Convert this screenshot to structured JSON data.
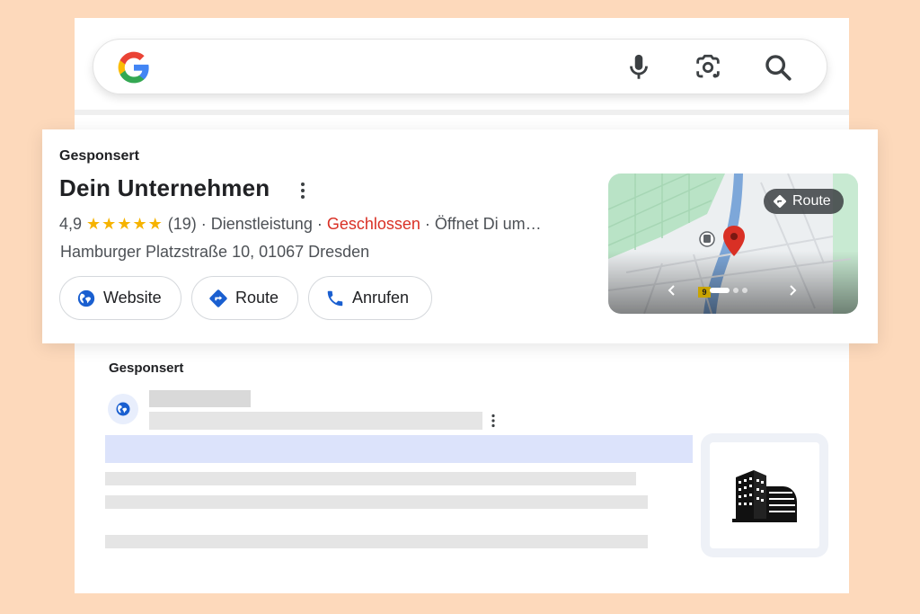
{
  "search": {
    "logo": "google-g-logo",
    "icons": [
      "microphone-icon",
      "google-lens-icon",
      "search-icon"
    ]
  },
  "card": {
    "sponsored_label": "Gesponsert",
    "business_name": "Dein Unternehmen",
    "rating": "4,9",
    "stars": "★★★★★",
    "review_count": "(19)",
    "category": " · Dienstleistung · ",
    "status": "Geschlossen",
    "hours": " · Öffnet Di um…",
    "address": "Hamburger Platzstraße 10, 01067 Dresden",
    "buttons": {
      "website": "Website",
      "route": "Route",
      "call": "Anrufen"
    },
    "map": {
      "route_label": "Route",
      "road_badge": "9",
      "carousel_position": 1,
      "carousel_count": 3
    }
  },
  "ad2": {
    "sponsored_label": "Gesponsert"
  },
  "colors": {
    "background": "#fdd9bb",
    "accent_blue": "#1a5fd0",
    "closed_red": "#d93025",
    "star": "#f6b300"
  }
}
